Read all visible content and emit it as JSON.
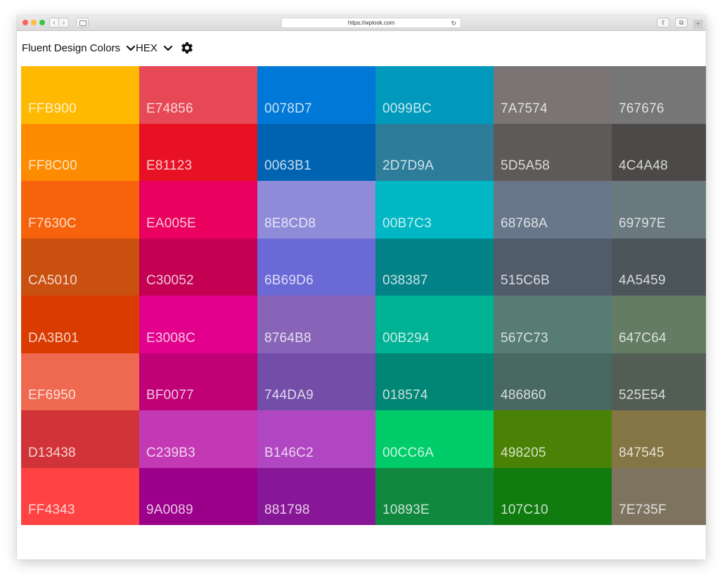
{
  "browser": {
    "url": "https://wplook.com",
    "icons": {
      "back": "chevron-left-icon",
      "forward": "chevron-right-icon",
      "sidebar": "sidebar-icon",
      "reload": "reload-icon",
      "share": "share-icon",
      "tabs": "tabs-icon",
      "new_tab": "plus-icon"
    }
  },
  "toolbar": {
    "palette_label": "Fluent Design Colors",
    "format_label": "HEX",
    "icons": {
      "dropdown": "chevron-down-icon",
      "settings": "gear-icon"
    }
  },
  "colors": [
    [
      "FFB900",
      "E74856",
      "0078D7",
      "0099BC",
      "7A7574",
      "767676"
    ],
    [
      "FF8C00",
      "E81123",
      "0063B1",
      "2D7D9A",
      "5D5A58",
      "4C4A48"
    ],
    [
      "F7630C",
      "EA005E",
      "8E8CD8",
      "00B7C3",
      "68768A",
      "69797E"
    ],
    [
      "CA5010",
      "C30052",
      "6B69D6",
      "038387",
      "515C6B",
      "4A5459"
    ],
    [
      "DA3B01",
      "E3008C",
      "8764B8",
      "00B294",
      "567C73",
      "647C64"
    ],
    [
      "EF6950",
      "BF0077",
      "744DA9",
      "018574",
      "486860",
      "525E54"
    ],
    [
      "D13438",
      "C239B3",
      "B146C2",
      "00CC6A",
      "498205",
      "847545"
    ],
    [
      "FF4343",
      "9A0089",
      "881798",
      "10893E",
      "107C10",
      "7E735F"
    ]
  ]
}
